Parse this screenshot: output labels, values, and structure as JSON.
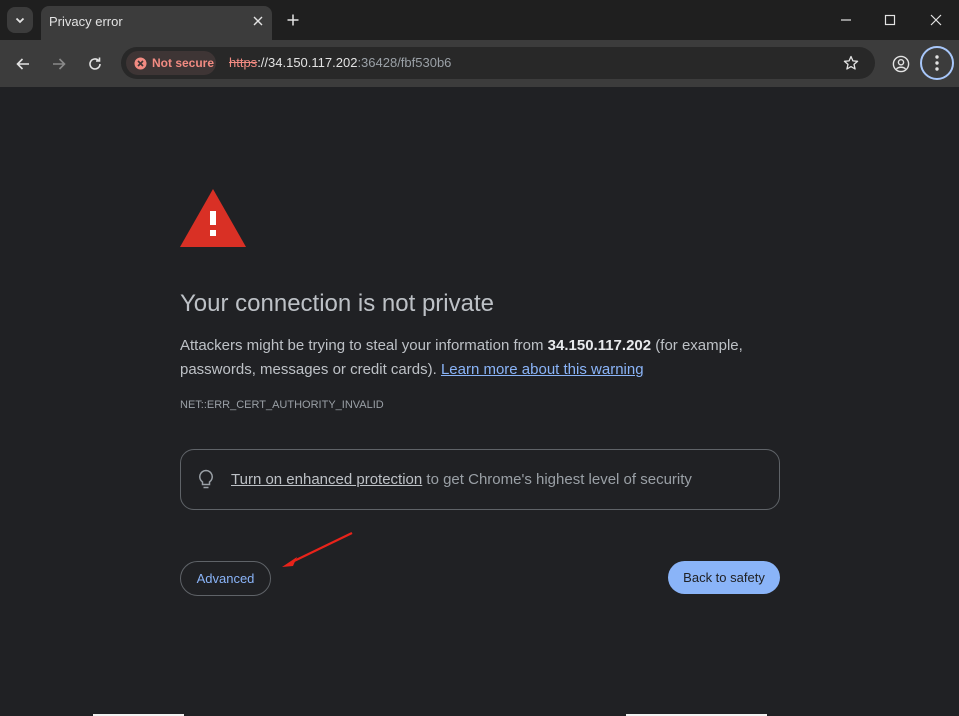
{
  "tab": {
    "title": "Privacy error"
  },
  "omnibox": {
    "security_chip": "Not secure",
    "url_scheme": "https",
    "url_host": "://34.150.117.202",
    "url_rest": ":36428/fbf530b6"
  },
  "page": {
    "headline": "Your connection is not private",
    "desc_pre": "Attackers might be trying to steal your information from ",
    "desc_host": "34.150.117.202",
    "desc_post": " (for example, passwords, messages or credit cards). ",
    "learn_more": "Learn more about this warning",
    "error_code": "NET::ERR_CERT_AUTHORITY_INVALID",
    "enhanced_link": "Turn on enhanced protection",
    "enhanced_rest": " to get Chrome's highest level of security",
    "advanced_label": "Advanced",
    "back_label": "Back to safety"
  },
  "colors": {
    "warning_red": "#d93025",
    "link_blue": "#8ab4f8",
    "annotation_arrow": "#e8231a"
  },
  "icons": [
    "chevron-down-icon",
    "close-icon",
    "plus-icon",
    "minimize-icon",
    "maximize-icon",
    "back-icon",
    "forward-icon",
    "reload-icon",
    "warning-icon",
    "star-icon",
    "profile-icon",
    "kebab-menu-icon",
    "lightbulb-icon"
  ]
}
